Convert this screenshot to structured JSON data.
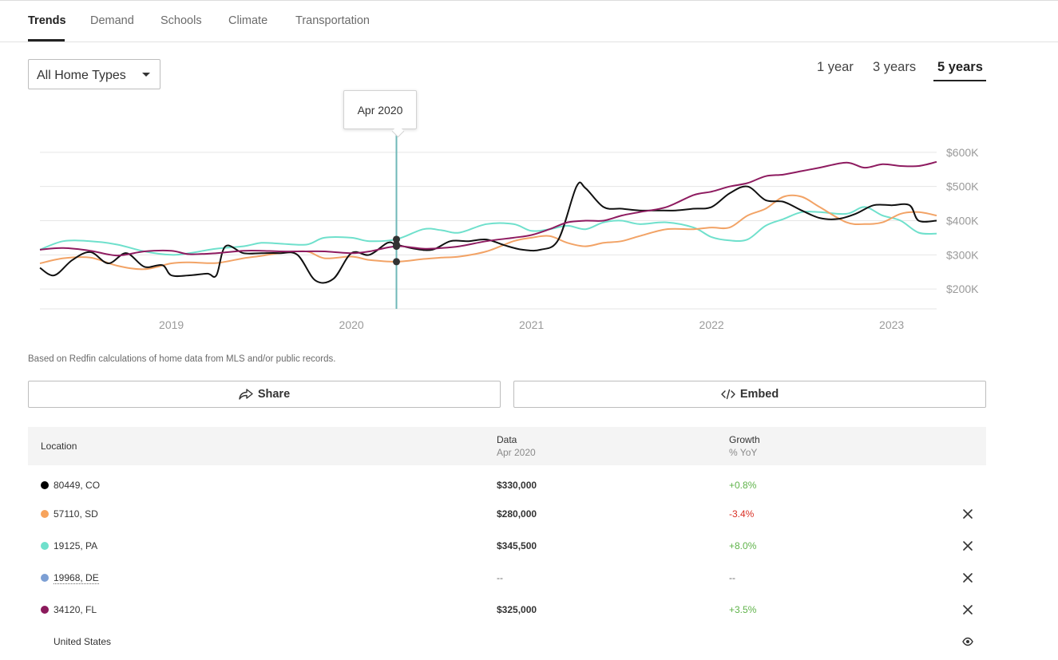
{
  "tabs": [
    {
      "label": "Trends",
      "active": true
    },
    {
      "label": "Demand",
      "active": false
    },
    {
      "label": "Schools",
      "active": false
    },
    {
      "label": "Climate",
      "active": false
    },
    {
      "label": "Transportation",
      "active": false
    }
  ],
  "filter": {
    "home_type": "All Home Types"
  },
  "ranges": [
    {
      "label": "1 year",
      "active": false
    },
    {
      "label": "3 years",
      "active": false
    },
    {
      "label": "5 years",
      "active": true
    }
  ],
  "tooltip": {
    "label": "Apr 2020"
  },
  "chart_data": {
    "type": "line",
    "x_unit": "year",
    "xlim": [
      2018.27,
      2023.25
    ],
    "ylim": [
      170000,
      630000
    ],
    "x_ticks": [
      {
        "label": "2019",
        "value": 2019
      },
      {
        "label": "2020",
        "value": 2020
      },
      {
        "label": "2021",
        "value": 2021
      },
      {
        "label": "2022",
        "value": 2022
      },
      {
        "label": "2023",
        "value": 2023
      }
    ],
    "y_ticks": [
      {
        "label": "$200K",
        "value": 200000
      },
      {
        "label": "$300K",
        "value": 300000
      },
      {
        "label": "$400K",
        "value": 400000
      },
      {
        "label": "$500K",
        "value": 500000
      },
      {
        "label": "$600K",
        "value": 600000
      }
    ],
    "gridlines": true,
    "highlight_x": 2020.25,
    "series": [
      {
        "color": "#13c4a3",
        "x": [
          2018.27,
          2018.4,
          2018.55,
          2018.7,
          2018.85,
          2019.0,
          2019.1,
          2019.25,
          2019.4,
          2019.5,
          2019.6,
          2019.75,
          2019.85,
          2020.0,
          2020.1,
          2020.25,
          2020.4,
          2020.5,
          2020.6,
          2020.75,
          2020.9,
          2021.0,
          2021.1,
          2021.2,
          2021.3,
          2021.4,
          2021.5,
          2021.6,
          2021.75,
          2021.9,
          2022.0,
          2022.1,
          2022.2,
          2022.3,
          2022.4,
          2022.5,
          2022.6,
          2022.75,
          2022.85,
          2022.95,
          2023.05,
          2023.15,
          2023.25
        ],
        "y": [
          315000,
          340000,
          340000,
          330000,
          310000,
          300000,
          305000,
          318000,
          325000,
          335000,
          333000,
          330000,
          350000,
          350000,
          340000,
          345500,
          375000,
          372000,
          365000,
          390000,
          390000,
          370000,
          375000,
          385000,
          375000,
          395000,
          400000,
          390000,
          395000,
          380000,
          352000,
          342000,
          345000,
          385000,
          405000,
          425000,
          425000,
          420000,
          440000,
          415000,
          400000,
          365000,
          362000
        ]
      },
      {
        "color": "#f7a35c",
        "x": [
          2018.27,
          2018.4,
          2018.55,
          2018.7,
          2018.85,
          2019.0,
          2019.1,
          2019.25,
          2019.4,
          2019.5,
          2019.6,
          2019.75,
          2019.85,
          2020.0,
          2020.1,
          2020.25,
          2020.4,
          2020.5,
          2020.6,
          2020.75,
          2020.9,
          2021.0,
          2021.1,
          2021.2,
          2021.3,
          2021.4,
          2021.5,
          2021.6,
          2021.75,
          2021.9,
          2022.0,
          2022.1,
          2022.2,
          2022.3,
          2022.4,
          2022.5,
          2022.6,
          2022.75,
          2022.85,
          2022.95,
          2023.05,
          2023.15,
          2023.25
        ],
        "y": [
          275000,
          290000,
          292000,
          268000,
          258000,
          275000,
          278000,
          276000,
          290000,
          297000,
          305000,
          310000,
          290000,
          295000,
          285000,
          280000,
          288000,
          292000,
          295000,
          310000,
          340000,
          350000,
          355000,
          335000,
          325000,
          335000,
          340000,
          355000,
          375000,
          375000,
          380000,
          380000,
          415000,
          435000,
          470000,
          470000,
          440000,
          395000,
          390000,
          395000,
          420000,
          425000,
          415000
        ]
      },
      {
        "color": "#000000",
        "x": [
          2018.27,
          2018.35,
          2018.45,
          2018.55,
          2018.65,
          2018.75,
          2018.85,
          2018.95,
          2019.0,
          2019.1,
          2019.2,
          2019.25,
          2019.3,
          2019.4,
          2019.5,
          2019.6,
          2019.7,
          2019.8,
          2019.9,
          2020.0,
          2020.1,
          2020.2,
          2020.25,
          2020.35,
          2020.45,
          2020.55,
          2020.65,
          2020.75,
          2020.85,
          2020.95,
          2021.05,
          2021.15,
          2021.25,
          2021.3,
          2021.4,
          2021.5,
          2021.6,
          2021.7,
          2021.8,
          2021.9,
          2022.0,
          2022.1,
          2022.2,
          2022.3,
          2022.4,
          2022.5,
          2022.6,
          2022.7,
          2022.8,
          2022.9,
          2023.0,
          2023.1,
          2023.15,
          2023.25
        ],
        "y": [
          262000,
          240000,
          285000,
          308000,
          275000,
          305000,
          265000,
          270000,
          240000,
          240000,
          245000,
          240000,
          325000,
          305000,
          305000,
          305000,
          300000,
          225000,
          230000,
          305000,
          300000,
          335000,
          330000,
          318000,
          315000,
          340000,
          340000,
          345000,
          328000,
          315000,
          315000,
          345000,
          500000,
          495000,
          440000,
          435000,
          430000,
          430000,
          430000,
          435000,
          440000,
          480000,
          500000,
          460000,
          455000,
          430000,
          408000,
          405000,
          420000,
          445000,
          445000,
          445000,
          400000,
          400000
        ]
      },
      {
        "color": "#8b1a5c",
        "x": [
          2018.27,
          2018.4,
          2018.55,
          2018.7,
          2018.85,
          2019.0,
          2019.1,
          2019.25,
          2019.4,
          2019.5,
          2019.6,
          2019.75,
          2019.85,
          2020.0,
          2020.1,
          2020.25,
          2020.4,
          2020.5,
          2020.6,
          2020.75,
          2020.9,
          2021.0,
          2021.1,
          2021.2,
          2021.3,
          2021.4,
          2021.5,
          2021.6,
          2021.75,
          2021.9,
          2022.0,
          2022.1,
          2022.2,
          2022.3,
          2022.4,
          2022.5,
          2022.6,
          2022.75,
          2022.85,
          2022.95,
          2023.05,
          2023.15,
          2023.25
        ],
        "y": [
          315000,
          320000,
          312000,
          298000,
          310000,
          312000,
          302000,
          305000,
          312000,
          312000,
          310000,
          310000,
          310000,
          305000,
          310000,
          325000,
          318000,
          320000,
          325000,
          340000,
          350000,
          358000,
          375000,
          395000,
          400000,
          400000,
          415000,
          425000,
          440000,
          475000,
          485000,
          500000,
          510000,
          530000,
          535000,
          545000,
          555000,
          570000,
          555000,
          565000,
          560000,
          560000,
          572000
        ]
      }
    ]
  },
  "footnote": "Based on Redfin calculations of home data from MLS and/or public records.",
  "buttons": {
    "share": "Share",
    "embed": "Embed"
  },
  "table": {
    "headers": {
      "location": "Location",
      "data": "Data",
      "data_sub": "Apr 2020",
      "growth": "Growth",
      "growth_sub": "% YoY"
    },
    "rows": [
      {
        "location": "80449, CO",
        "color": "#000000",
        "value": "$330,000",
        "growth": "+0.8%",
        "growth_color": "#5fb34a",
        "removable": false
      },
      {
        "location": "57110, SD",
        "color": "#f7a35c",
        "value": "$280,000",
        "growth": "-3.4%",
        "growth_color": "#d93025",
        "removable": true
      },
      {
        "location": "19125, PA",
        "color": "#6fe0cc",
        "value": "$345,500",
        "growth": "+8.0%",
        "growth_color": "#5fb34a",
        "removable": true
      },
      {
        "location": "19968, DE",
        "color": "#7c9fd4",
        "value": "--",
        "growth": "--",
        "growth_color": "#6b6b6b",
        "removable": true
      },
      {
        "location": "34120, FL",
        "color": "#8b1a5c",
        "value": "$325,000",
        "growth": "+3.5%",
        "growth_color": "#5fb34a",
        "removable": true
      },
      {
        "location": "United States",
        "color": "",
        "value": "",
        "growth": "",
        "growth_color": "#6b6b6b",
        "removable": false
      }
    ]
  },
  "icons": {
    "share": "share-arrow-icon",
    "embed": "code-embed-icon",
    "remove": "close-icon",
    "visibility": "eye-icon",
    "dropdown": "caret-down-icon"
  }
}
